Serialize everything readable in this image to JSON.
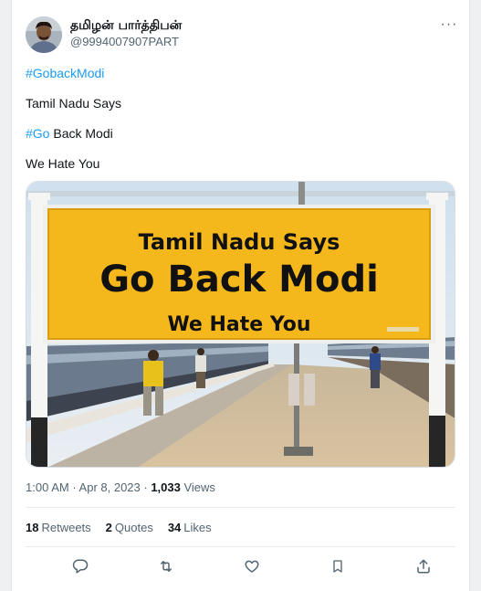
{
  "author": {
    "display_name": "தமிழன் பார்த்திபன்",
    "handle": "@9994007907PART"
  },
  "more_label": "···",
  "tweet": {
    "line1_hashtag": "#GobackModi",
    "line2": "Tamil Nadu Says",
    "line3_hashtag": "#Go",
    "line3_rest": " Back Modi",
    "line4": "We Hate You"
  },
  "image_sign": {
    "line1": "Tamil Nadu Says",
    "line2": "Go Back Modi",
    "line3": "We Hate You"
  },
  "meta": {
    "time": "1:00 AM",
    "separator1": " · ",
    "date": "Apr 8, 2023",
    "separator2": " · ",
    "views_count": "1,033",
    "views_label": " Views"
  },
  "stats": {
    "retweets_count": "18",
    "retweets_label": "Retweets",
    "quotes_count": "2",
    "quotes_label": "Quotes",
    "likes_count": "34",
    "likes_label": "Likes"
  },
  "actions": [
    {
      "icon": "reply-icon"
    },
    {
      "icon": "retweet-icon"
    },
    {
      "icon": "like-icon"
    },
    {
      "icon": "bookmark-icon"
    },
    {
      "icon": "share-icon"
    }
  ],
  "colors": {
    "accent": "#1d9bf0",
    "secondary_text": "#536471",
    "sign_yellow": "#f4b81c"
  }
}
